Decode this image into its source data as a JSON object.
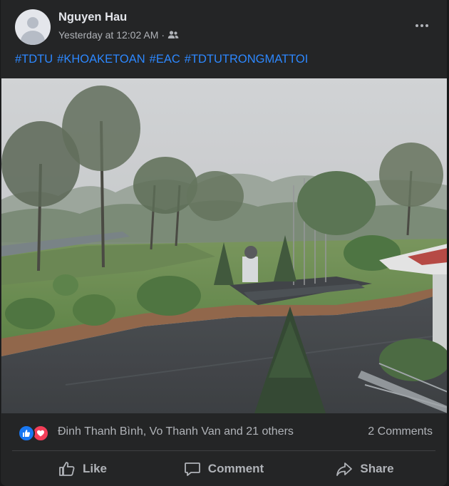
{
  "post": {
    "author": "Nguyen Hau",
    "timestamp": "Yesterday at 12:02 AM",
    "separator": "·",
    "audience_icon": "friends-icon",
    "hashtags": [
      "#TDTU",
      "#KHOAKETOAN",
      "#EAC",
      "#TDTUTRONGMATTOI"
    ]
  },
  "reactions": {
    "icons": [
      "like-reaction-icon",
      "love-reaction-icon"
    ],
    "names": "Đinh Thanh Bình, Vo Thanh Van and 21 others",
    "comments": "2 Comments"
  },
  "actions": {
    "like": "Like",
    "comment": "Comment",
    "share": "Share"
  },
  "colors": {
    "background": "#242526",
    "text": "#e4e6eb",
    "secondary_text": "#b0b3b8",
    "link": "#2d88ff",
    "like_blue": "#1877f2",
    "love_red": "#f33e58"
  }
}
